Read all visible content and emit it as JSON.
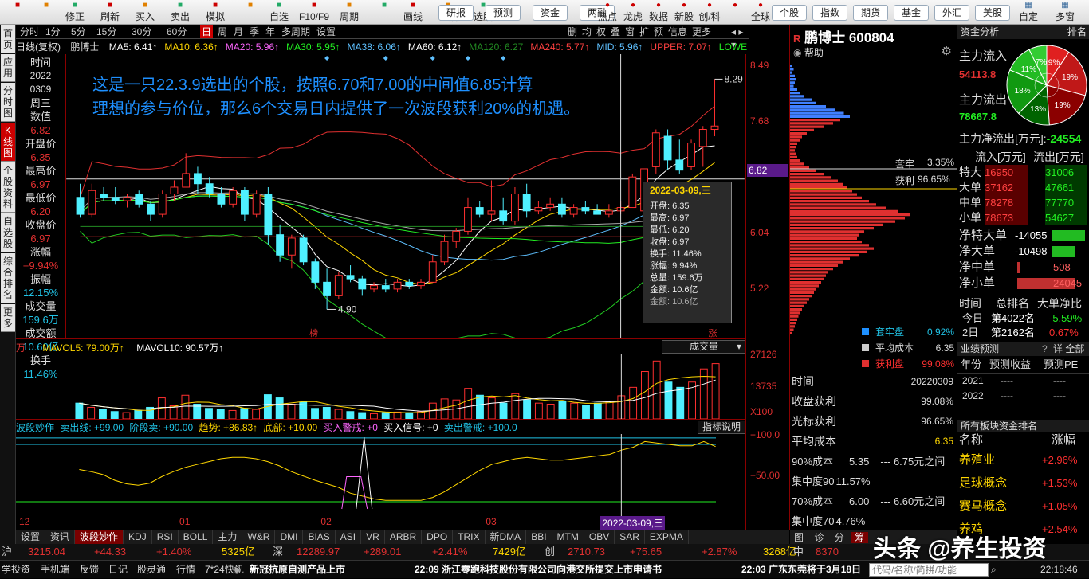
{
  "toolbar": {
    "items": [
      "",
      "",
      "修正",
      "刷新",
      "买入",
      "卖出",
      "模拟",
      "",
      "自选",
      "F10/F9",
      "周期",
      "",
      "画线",
      "论股",
      "选股"
    ],
    "right_buttons": [
      "研报",
      "预测",
      "资金",
      "两融"
    ],
    "right_items": [
      "热点",
      "龙虎",
      "数据",
      "新股",
      "创/科",
      "",
      "全球"
    ],
    "far_right_buttons": [
      "个股",
      "指数",
      "期货",
      "基金",
      "外汇",
      "美股"
    ],
    "end_items": [
      "自定",
      "多窗"
    ]
  },
  "side_tabs": [
    "首页",
    "应用",
    "分时图",
    "K线图",
    "个股资料",
    "自选股",
    "综合排名",
    "更多"
  ],
  "period_bar": {
    "items": [
      "分时",
      "1分",
      "5分",
      "15分",
      "30分",
      "60分",
      "日",
      "周",
      "月",
      "季",
      "年",
      "多周期",
      "设置"
    ],
    "active": "日",
    "right": [
      "删",
      "均",
      "权",
      "叠",
      "窗",
      "扩",
      "预",
      "信息",
      "更多"
    ]
  },
  "ma_bar": {
    "label": "日线(复权)",
    "stock": "鹏博士",
    "items": [
      {
        "text": "MA5: 6.41↑",
        "color": "#ffffff"
      },
      {
        "text": "MA10: 6.36↑",
        "color": "#ffd700"
      },
      {
        "text": "MA20: 5.96↑",
        "color": "#ff66ff"
      },
      {
        "text": "MA30: 5.95↑",
        "color": "#22ee22"
      },
      {
        "text": "MA38: 6.06↑",
        "color": "#5ec0ff"
      },
      {
        "text": "MA60: 6.12↑",
        "color": "#ffffff"
      },
      {
        "text": "MA120: 6.27",
        "color": "#228b22"
      },
      {
        "text": "MA240: 5.77↑",
        "color": "#ff4040"
      },
      {
        "text": "MID: 5.96↑",
        "color": "#5ec0ff"
      },
      {
        "text": "UPPER: 7.07↑",
        "color": "#ff4040"
      },
      {
        "text": "LOWE",
        "color": "#22ee22"
      }
    ]
  },
  "info_col": [
    {
      "label": "时间",
      "value": "2022"
    },
    {
      "label": "",
      "value": "0309"
    },
    {
      "label": "周三",
      "value": ""
    },
    {
      "label": "数值",
      "value": "6.82"
    },
    {
      "label": "开盘价",
      "value": "6.35"
    },
    {
      "label": "最高价",
      "value": "6.97"
    },
    {
      "label": "最低价",
      "value": "6.20"
    },
    {
      "label": "收盘价",
      "value": "6.97"
    },
    {
      "label": "涨幅",
      "value": "+9.94%"
    },
    {
      "label": "振幅",
      "value": "12.15%"
    },
    {
      "label": "成交量",
      "value": "159.6万"
    },
    {
      "label": "成交额",
      "value": "10.60亿"
    },
    {
      "label": "换手",
      "value": "11.46%"
    }
  ],
  "overlay_text": {
    "line1": "这是一只22.3.9选出的个股，按照6.70和7.00的中间值6.85计算",
    "line2": "理想的参与价位，那么6个交易日内提供了一次波段获利20%的机遇。"
  },
  "chart_data": {
    "type": "candlestick",
    "y_axis_labels": [
      "8.49",
      "7.68",
      "6.82",
      "6.04",
      "5.22"
    ],
    "price_range": [
      4.6,
      8.6
    ],
    "current_price_line": 6.82,
    "high_annotation": "8.29",
    "low_annotation": "4.90",
    "candles": [
      {
        "o": 6.55,
        "h": 6.75,
        "l": 6.25,
        "c": 6.3
      },
      {
        "o": 6.3,
        "h": 6.75,
        "l": 6.25,
        "c": 6.65
      },
      {
        "o": 6.6,
        "h": 6.7,
        "l": 6.5,
        "c": 6.55
      },
      {
        "o": 6.55,
        "h": 6.7,
        "l": 6.45,
        "c": 6.5
      },
      {
        "o": 6.5,
        "h": 6.6,
        "l": 6.4,
        "c": 6.55
      },
      {
        "o": 6.6,
        "h": 6.65,
        "l": 6.4,
        "c": 6.45
      },
      {
        "o": 6.45,
        "h": 6.5,
        "l": 6.2,
        "c": 6.3
      },
      {
        "o": 6.3,
        "h": 6.65,
        "l": 6.25,
        "c": 6.6
      },
      {
        "o": 6.6,
        "h": 6.8,
        "l": 6.5,
        "c": 6.7
      },
      {
        "o": 6.7,
        "h": 7.2,
        "l": 6.7,
        "c": 6.9
      },
      {
        "o": 6.9,
        "h": 7.0,
        "l": 6.6,
        "c": 6.75
      },
      {
        "o": 6.75,
        "h": 6.85,
        "l": 6.55,
        "c": 6.6
      },
      {
        "o": 6.6,
        "h": 6.7,
        "l": 6.4,
        "c": 6.45
      },
      {
        "o": 6.45,
        "h": 6.7,
        "l": 6.4,
        "c": 6.65
      },
      {
        "o": 6.65,
        "h": 6.7,
        "l": 6.2,
        "c": 6.3
      },
      {
        "o": 6.3,
        "h": 6.65,
        "l": 6.25,
        "c": 6.6
      },
      {
        "o": 6.6,
        "h": 6.7,
        "l": 5.85,
        "c": 6.0
      },
      {
        "o": 6.0,
        "h": 6.15,
        "l": 5.6,
        "c": 5.7
      },
      {
        "o": 5.7,
        "h": 6.0,
        "l": 5.5,
        "c": 5.95
      },
      {
        "o": 5.95,
        "h": 6.0,
        "l": 5.55,
        "c": 5.6
      },
      {
        "o": 5.6,
        "h": 5.65,
        "l": 5.2,
        "c": 5.3
      },
      {
        "o": 5.3,
        "h": 5.5,
        "l": 4.9,
        "c": 5.1
      },
      {
        "o": 5.1,
        "h": 5.45,
        "l": 5.05,
        "c": 5.4
      },
      {
        "o": 5.4,
        "h": 5.55,
        "l": 5.3,
        "c": 5.35
      },
      {
        "o": 5.35,
        "h": 5.4,
        "l": 5.1,
        "c": 5.2
      },
      {
        "o": 5.2,
        "h": 5.3,
        "l": 5.15,
        "c": 5.25
      },
      {
        "o": 5.25,
        "h": 5.35,
        "l": 5.15,
        "c": 5.2
      },
      {
        "o": 5.2,
        "h": 5.35,
        "l": 5.15,
        "c": 5.3
      },
      {
        "o": 5.3,
        "h": 5.35,
        "l": 5.2,
        "c": 5.25
      },
      {
        "o": 5.25,
        "h": 5.35,
        "l": 5.2,
        "c": 5.3
      },
      {
        "o": 5.3,
        "h": 5.7,
        "l": 5.3,
        "c": 5.6
      },
      {
        "o": 5.6,
        "h": 6.0,
        "l": 5.55,
        "c": 5.9
      },
      {
        "o": 5.9,
        "h": 6.1,
        "l": 5.8,
        "c": 6.05
      },
      {
        "o": 6.05,
        "h": 6.55,
        "l": 6.0,
        "c": 6.4
      },
      {
        "o": 6.4,
        "h": 6.5,
        "l": 6.25,
        "c": 6.3
      },
      {
        "o": 6.3,
        "h": 6.8,
        "l": 6.2,
        "c": 6.35
      },
      {
        "o": 6.35,
        "h": 6.55,
        "l": 6.15,
        "c": 6.2
      },
      {
        "o": 6.2,
        "h": 6.7,
        "l": 6.15,
        "c": 6.6
      },
      {
        "o": 6.6,
        "h": 6.75,
        "l": 6.25,
        "c": 6.35
      },
      {
        "o": 6.35,
        "h": 6.5,
        "l": 6.3,
        "c": 6.4
      },
      {
        "o": 6.4,
        "h": 6.55,
        "l": 6.35,
        "c": 6.45
      },
      {
        "o": 6.45,
        "h": 6.55,
        "l": 6.25,
        "c": 6.3
      },
      {
        "o": 6.3,
        "h": 6.45,
        "l": 6.25,
        "c": 6.4
      },
      {
        "o": 6.4,
        "h": 6.5,
        "l": 6.3,
        "c": 6.35
      },
      {
        "o": 6.35,
        "h": 6.45,
        "l": 6.3,
        "c": 6.3
      },
      {
        "o": 6.3,
        "h": 6.45,
        "l": 6.25,
        "c": 6.35
      },
      {
        "o": 6.35,
        "h": 6.5,
        "l": 6.3,
        "c": 6.4
      },
      {
        "o": 6.4,
        "h": 6.9,
        "l": 6.4,
        "c": 6.85
      },
      {
        "o": 6.35,
        "h": 6.97,
        "l": 6.2,
        "c": 6.97
      },
      {
        "o": 7.0,
        "h": 7.55,
        "l": 6.9,
        "c": 7.5
      },
      {
        "o": 7.45,
        "h": 7.55,
        "l": 6.95,
        "c": 7.1
      },
      {
        "o": 7.1,
        "h": 7.4,
        "l": 6.9,
        "c": 6.95
      },
      {
        "o": 7.0,
        "h": 7.4,
        "l": 6.95,
        "c": 7.35
      },
      {
        "o": 7.3,
        "h": 7.6,
        "l": 7.0,
        "c": 7.55
      },
      {
        "o": 7.55,
        "h": 8.29,
        "l": 7.45,
        "c": 7.6
      }
    ],
    "volume": [
      30,
      22,
      18,
      14,
      12,
      16,
      22,
      40,
      25,
      45,
      28,
      20,
      18,
      16,
      20,
      18,
      46,
      40,
      28,
      32,
      20,
      22,
      18,
      14,
      12,
      10,
      12,
      13,
      12,
      14,
      30,
      38,
      36,
      58,
      45,
      40,
      30,
      48,
      36,
      30,
      28,
      34,
      30,
      26,
      30,
      34,
      44,
      60,
      90,
      110,
      70,
      60,
      70,
      95,
      105
    ],
    "volume_labels": {
      "mavol5": "MAVOL5: 79.00万↑",
      "mavol10": "MAVOL10: 90.57万↑",
      "unit": "万",
      "axis": [
        "27126",
        "13735",
        "X100"
      ],
      "select": "成交量"
    },
    "indicator_labels": {
      "name": "波段妙作",
      "items": [
        {
          "text": "卖出线: +99.00",
          "color": "#21c3e6"
        },
        {
          "text": "阶段卖: +90.00",
          "color": "#21c3e6"
        },
        {
          "text": "趋势: +86.83↑",
          "color": "#ffd700"
        },
        {
          "text": "底部: +10.00",
          "color": "#ffd700"
        },
        {
          "text": "买入警戒: +0",
          "color": "#ff66ff"
        },
        {
          "text": "买入信号: +0",
          "color": "#ffffff"
        },
        {
          "text": "卖出警戒: +100.0",
          "color": "#21c3e6"
        }
      ],
      "axis": [
        "+100.0",
        "+50.00"
      ],
      "help": "指标说明"
    },
    "trend": [
      55,
      52,
      48,
      40,
      35,
      33,
      36,
      45,
      52,
      58,
      62,
      66,
      70,
      72,
      72,
      70,
      66,
      60,
      52,
      46,
      40,
      35,
      30,
      22,
      18,
      14,
      12,
      12,
      12,
      12,
      16,
      24,
      34,
      44,
      54,
      62,
      66,
      70,
      72,
      70,
      68,
      68,
      70,
      72,
      74,
      76,
      82,
      86,
      94,
      92,
      90,
      88,
      88,
      94,
      87
    ],
    "x_labels": [
      {
        "text": "12",
        "idx": 0
      },
      {
        "text": "01",
        "idx": 9
      },
      {
        "text": "02",
        "idx": 21
      },
      {
        "text": "03",
        "idx": 35
      }
    ],
    "marker_top": "榜",
    "marker_zhang": "涨"
  },
  "tooltip": {
    "date": "2022-03-09,三",
    "rows": [
      "开盘: 6.35",
      "最高: 6.97",
      "最低: 6.20",
      "收盘: 6.97",
      "换手: 11.46%",
      "涨幅: 9.94%",
      "总量: 159.6万",
      "金额: 10.6亿"
    ],
    "ghost": "金额: 10.6亿"
  },
  "cursor_date": "2022-03-09,三",
  "indicator_tabs": {
    "items": [
      "设置",
      "资讯",
      "波段妙作",
      "KDJ",
      "RSI",
      "BOLL",
      "主力",
      "W&R",
      "DMI",
      "BIAS",
      "ASI",
      "VR",
      "ARBR",
      "DPO",
      "TRIX",
      "新DMA",
      "BBI",
      "MTM",
      "OBV",
      "SAR",
      "EXPMA"
    ],
    "active": "波段妙作"
  },
  "chip_panel": {
    "title": "鹏博士 600804",
    "prefix": "R",
    "help": "帮助",
    "trapped_label": "套牢",
    "trapped_value": "3.35%",
    "profit_label": "获利",
    "profit_value": "96.65%",
    "price_tag": "6.82",
    "legend": [
      {
        "label": "套牢盘",
        "value": "0.92%",
        "color": "#1e90ff"
      },
      {
        "label": "平均成本",
        "value": "6.35",
        "color": "#cccccc"
      },
      {
        "label": "获利盘",
        "value": "99.08%",
        "color": "#e03030"
      }
    ],
    "stats": [
      {
        "label": "时间",
        "value": "20220309"
      },
      {
        "label": "收盘获利",
        "value": "99.08%"
      },
      {
        "label": "光标获利",
        "value": "96.65%"
      },
      {
        "label": "平均成本",
        "value": "6.35"
      }
    ],
    "cost90": {
      "label": "90%成本",
      "value": "5.35",
      "range": "--- 6.75元之间"
    },
    "conc90": {
      "label": "集中度90",
      "value": "11.57%"
    },
    "cost70": {
      "label": "70%成本",
      "value": "6.00",
      "range": "--- 6.60元之间"
    },
    "conc70": {
      "label": "集中度70",
      "value": "4.76%"
    },
    "bottom_tabs": [
      "筹"
    ],
    "profile": [
      2,
      3,
      2,
      4,
      5,
      4,
      3,
      6,
      8,
      12,
      18,
      22,
      30,
      38,
      45,
      50,
      42,
      36,
      28,
      20,
      14,
      10,
      8,
      6,
      5,
      4,
      5,
      6,
      8,
      12,
      16,
      22,
      28,
      34,
      40,
      44,
      48,
      52,
      56,
      60,
      66,
      72,
      80,
      90,
      100,
      96,
      88,
      78,
      70,
      62,
      58,
      56,
      60,
      66,
      70,
      64,
      58,
      50,
      44,
      40,
      36,
      32,
      30,
      28,
      26,
      24,
      22,
      20,
      18,
      16,
      14,
      12,
      10,
      8,
      7,
      6,
      5,
      4,
      3,
      2
    ]
  },
  "right_panel": {
    "title": "资金分析",
    "rank": "排名",
    "main_in_label": "主力流入",
    "main_in_value": "54113.8",
    "main_out_label": "主力流出",
    "main_out_value": "78667.8",
    "net_label": "主力净流出[万元]:",
    "net_value": "-24554",
    "pie": [
      {
        "label": "9%",
        "value": 9,
        "color": "#e02020"
      },
      {
        "label": "19%",
        "value": 19,
        "color": "#c01818"
      },
      {
        "label": "19%",
        "value": 19,
        "color": "#8b0000"
      },
      {
        "label": "13%",
        "value": 13,
        "color": "#006400"
      },
      {
        "label": "18%",
        "value": 18,
        "color": "#119911"
      },
      {
        "label": "11%",
        "value": 11,
        "color": "#22bb22"
      },
      {
        "label": "7%",
        "value": 7,
        "color": "#33cc33"
      }
    ],
    "flow_header": [
      "流入[万元]",
      "流出[万元]"
    ],
    "flows": [
      {
        "label": "特大",
        "in": "16950",
        "out": "31006"
      },
      {
        "label": "大单",
        "in": "37162",
        "out": "47661"
      },
      {
        "label": "中单",
        "in": "78278",
        "out": "77770"
      },
      {
        "label": "小单",
        "in": "78673",
        "out": "54627"
      }
    ],
    "nets": [
      {
        "label": "净特大单",
        "value": "-14055",
        "color": "#22ee22",
        "bar": 0.35
      },
      {
        "label": "净大单",
        "value": "-10498",
        "color": "#22ee22",
        "bar": 0.25
      },
      {
        "label": "净中单",
        "value": "508",
        "color": "#e03030",
        "bar": 0.03
      },
      {
        "label": "净小单",
        "value": "24045",
        "color": "#e03030",
        "bar": 0.6
      }
    ],
    "rank_header": [
      "时间",
      "总排名",
      "大单净比"
    ],
    "ranks": [
      {
        "t": "今日",
        "r": "第4022名",
        "v": "-5.59%"
      },
      {
        "t": "2日",
        "r": "第2162名",
        "v": "0.67%"
      }
    ],
    "forecast_title": "业绩预测",
    "forecast_help": "?",
    "forecast_tabs": [
      "年份",
      "预测收益",
      "预测PE"
    ],
    "forecast_rows": [
      {
        "y": "2021",
        "a": "----",
        "b": "----"
      },
      {
        "y": "2022",
        "a": "----",
        "b": "----"
      }
    ],
    "forecast_all": "详 全部",
    "sector_title": "所有板块资金排名",
    "sector_header": [
      "名称",
      "涨幅"
    ],
    "sectors": [
      {
        "n": "养殖业",
        "v": "+2.96%"
      },
      {
        "n": "足球概念",
        "v": "+1.53%"
      },
      {
        "n": "赛马概念",
        "v": "+1.05%"
      },
      {
        "n": "养鸡",
        "v": "+2.54%"
      }
    ]
  },
  "market_bar": [
    {
      "t": "沪",
      "c": "#ccc"
    },
    {
      "t": "3215.04",
      "c": "#e03030"
    },
    {
      "t": "+44.33",
      "c": "#e03030"
    },
    {
      "t": "+1.40%",
      "c": "#e03030"
    },
    {
      "t": "5325亿",
      "c": "#ffd700"
    },
    {
      "t": "深",
      "c": "#ccc"
    },
    {
      "t": "12289.97",
      "c": "#e03030"
    },
    {
      "t": "+289.01",
      "c": "#e03030"
    },
    {
      "t": "+2.41%",
      "c": "#e03030"
    },
    {
      "t": "7429亿",
      "c": "#ffd700"
    },
    {
      "t": "创",
      "c": "#ccc"
    },
    {
      "t": "2710.73",
      "c": "#e03030"
    },
    {
      "t": "+75.65",
      "c": "#e03030"
    },
    {
      "t": "+2.87%",
      "c": "#e03030"
    },
    {
      "t": "3268亿",
      "c": "#ffd700"
    },
    {
      "t": "中",
      "c": "#ccc"
    },
    {
      "t": "8370",
      "c": "#e03030"
    }
  ],
  "status_bar": {
    "items": [
      "学投资",
      "手机端",
      "反馈",
      "日记",
      "股灵通",
      "行情",
      "7*24快讯"
    ],
    "news": [
      "新冠抗原自测产品上市",
      "22:09  浙江零跑科技股份有限公司向港交所提交上市申请书",
      "22:03  广东东莞将于3月18日"
    ],
    "search_placeholder": "代码/名称/简拼/功能",
    "time": "22:18:46"
  },
  "watermark": "头条 @养生投资"
}
